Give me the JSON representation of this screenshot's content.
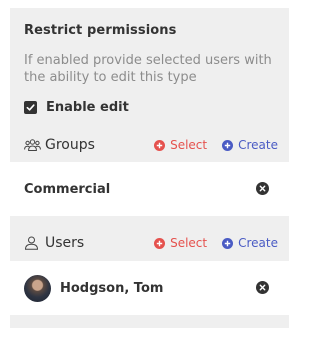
{
  "permissions": {
    "title": "Restrict permissions",
    "description": "If enabled provide selected users with the ability to edit this type",
    "enable_edit_label": "Enable edit",
    "enable_edit_checked": true
  },
  "groups": {
    "label": "Groups",
    "icon": "users-group-icon",
    "select_label": "Select",
    "create_label": "Create",
    "items": [
      {
        "label": "Commercial"
      }
    ]
  },
  "users": {
    "label": "Users",
    "icon": "user-icon",
    "select_label": "Select",
    "create_label": "Create",
    "items": [
      {
        "label": "Hodgson, Tom"
      }
    ]
  },
  "colors": {
    "select": "#e5514d",
    "create": "#4a5bc4",
    "panel_bg": "#efefef"
  }
}
